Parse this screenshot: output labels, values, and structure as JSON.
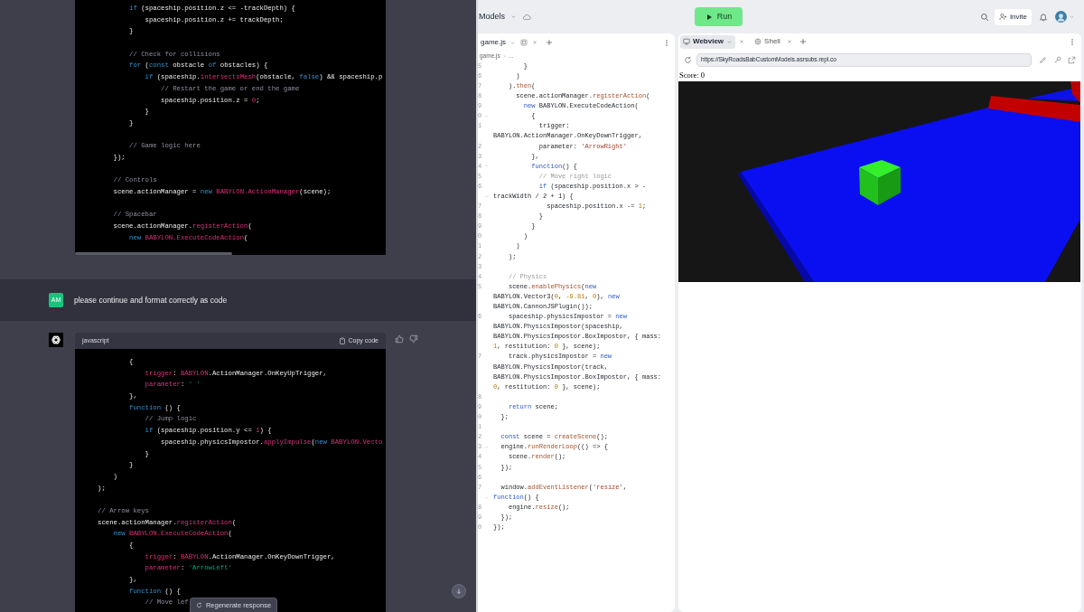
{
  "chat": {
    "code_block_1": {
      "lines": [
        {
          "kind": "code",
          "segments": [
            {
              "text": "        if",
              "kind": "kw"
            },
            {
              "text": " (spaceship.position.z <= -trackDepth) {",
              "kind": "plain"
            }
          ]
        },
        {
          "kind": "code",
          "segments": [
            {
              "text": "            spaceship.position.z += trackDepth;",
              "kind": "plain"
            }
          ]
        },
        {
          "kind": "code",
          "segments": [
            {
              "text": "        }",
              "kind": "plain"
            }
          ]
        },
        {
          "kind": "blank"
        },
        {
          "kind": "code",
          "segments": [
            {
              "text": "        // Check for collisions",
              "kind": "com"
            }
          ]
        },
        {
          "kind": "code",
          "segments": [
            {
              "text": "        for",
              "kind": "kw"
            },
            {
              "text": " (",
              "kind": "plain"
            },
            {
              "text": "const",
              "kind": "kw"
            },
            {
              "text": " obstacle ",
              "kind": "plain"
            },
            {
              "text": "of",
              "kind": "kw"
            },
            {
              "text": " obstacles) {",
              "kind": "plain"
            }
          ]
        },
        {
          "kind": "code",
          "segments": [
            {
              "text": "            if",
              "kind": "kw"
            },
            {
              "text": " (spaceship.",
              "kind": "plain"
            },
            {
              "text": "intersectsMesh",
              "kind": "fn"
            },
            {
              "text": "(obstacle, ",
              "kind": "plain"
            },
            {
              "text": "false",
              "kind": "kw"
            },
            {
              "text": ") && spaceship.p",
              "kind": "plain"
            }
          ]
        },
        {
          "kind": "code",
          "segments": [
            {
              "text": "                // Restart the game or end the game",
              "kind": "com"
            }
          ]
        },
        {
          "kind": "code",
          "segments": [
            {
              "text": "                spaceship.position.z = ",
              "kind": "plain"
            },
            {
              "text": "0",
              "kind": "num"
            },
            {
              "text": ";",
              "kind": "plain"
            }
          ]
        },
        {
          "kind": "code",
          "segments": [
            {
              "text": "            }",
              "kind": "plain"
            }
          ]
        },
        {
          "kind": "code",
          "segments": [
            {
              "text": "        }",
              "kind": "plain"
            }
          ]
        },
        {
          "kind": "blank"
        },
        {
          "kind": "code",
          "segments": [
            {
              "text": "        // Game logic here",
              "kind": "com"
            }
          ]
        },
        {
          "kind": "code",
          "segments": [
            {
              "text": "    });",
              "kind": "plain"
            }
          ]
        },
        {
          "kind": "blank"
        },
        {
          "kind": "code",
          "segments": [
            {
              "text": "    // Controls",
              "kind": "com"
            }
          ]
        },
        {
          "kind": "code",
          "segments": [
            {
              "text": "    scene.actionManager = ",
              "kind": "plain"
            },
            {
              "text": "new",
              "kind": "kw"
            },
            {
              "text": " BABYLON.ActionManager",
              "kind": "fn"
            },
            {
              "text": "(scene);",
              "kind": "plain"
            }
          ]
        },
        {
          "kind": "blank"
        },
        {
          "kind": "code",
          "segments": [
            {
              "text": "    // Spacebar",
              "kind": "com"
            }
          ]
        },
        {
          "kind": "code",
          "segments": [
            {
              "text": "    scene.actionManager.",
              "kind": "plain"
            },
            {
              "text": "registerAction",
              "kind": "fn"
            },
            {
              "text": "(",
              "kind": "plain"
            }
          ]
        },
        {
          "kind": "code",
          "segments": [
            {
              "text": "        new",
              "kind": "kw"
            },
            {
              "text": " BABYLON.ExecuteCodeAction",
              "kind": "fn"
            },
            {
              "text": "(",
              "kind": "plain"
            }
          ]
        }
      ]
    },
    "user_message": {
      "avatar": "AM",
      "text": "please continue and format correctly as code"
    },
    "assistant_message": {
      "code_block": {
        "language": "javascript",
        "copy_label": "Copy code",
        "lines": [
          {
            "kind": "code",
            "segments": [
              {
                "text": "        {",
                "kind": "plain"
              }
            ]
          },
          {
            "kind": "code",
            "segments": [
              {
                "text": "            trigger",
                "kind": "fn"
              },
              {
                "text": ": ",
                "kind": "plain"
              },
              {
                "text": "BABYLON",
                "kind": "fn"
              },
              {
                "text": ".ActionManager.OnKeyUpTrigger,",
                "kind": "plain"
              }
            ]
          },
          {
            "kind": "code",
            "segments": [
              {
                "text": "            parameter",
                "kind": "fn"
              },
              {
                "text": ": ",
                "kind": "plain"
              },
              {
                "text": "' '",
                "kind": "str"
              }
            ]
          },
          {
            "kind": "code",
            "segments": [
              {
                "text": "        },",
                "kind": "plain"
              }
            ]
          },
          {
            "kind": "code",
            "segments": [
              {
                "text": "        function",
                "kind": "kw"
              },
              {
                "text": " () {",
                "kind": "plain"
              }
            ]
          },
          {
            "kind": "code",
            "segments": [
              {
                "text": "            // Jump logic",
                "kind": "com"
              }
            ]
          },
          {
            "kind": "code",
            "segments": [
              {
                "text": "            if",
                "kind": "kw"
              },
              {
                "text": " (spaceship.position.y <= ",
                "kind": "plain"
              },
              {
                "text": "1",
                "kind": "num"
              },
              {
                "text": ") {",
                "kind": "plain"
              }
            ]
          },
          {
            "kind": "code",
            "segments": [
              {
                "text": "                spaceship.physicsImpostor.",
                "kind": "plain"
              },
              {
                "text": "applyImpulse",
                "kind": "fn"
              },
              {
                "text": "(",
                "kind": "plain"
              },
              {
                "text": "new",
                "kind": "kw"
              },
              {
                "text": " BABYLON.Vecto",
                "kind": "fn"
              }
            ]
          },
          {
            "kind": "code",
            "segments": [
              {
                "text": "            }",
                "kind": "plain"
              }
            ]
          },
          {
            "kind": "code",
            "segments": [
              {
                "text": "        }",
                "kind": "plain"
              }
            ]
          },
          {
            "kind": "code",
            "segments": [
              {
                "text": "    )",
                "kind": "plain"
              }
            ]
          },
          {
            "kind": "code",
            "segments": [
              {
                "text": ");",
                "kind": "plain"
              }
            ]
          },
          {
            "kind": "blank"
          },
          {
            "kind": "code",
            "segments": [
              {
                "text": "// Arrow keys",
                "kind": "com"
              }
            ]
          },
          {
            "kind": "code",
            "segments": [
              {
                "text": "scene.actionManager.",
                "kind": "plain"
              },
              {
                "text": "registerAction",
                "kind": "fn"
              },
              {
                "text": "(",
                "kind": "plain"
              }
            ]
          },
          {
            "kind": "code",
            "segments": [
              {
                "text": "    new",
                "kind": "kw"
              },
              {
                "text": " BABYLON.ExecuteCodeAction",
                "kind": "fn"
              },
              {
                "text": "(",
                "kind": "plain"
              }
            ]
          },
          {
            "kind": "code",
            "segments": [
              {
                "text": "        {",
                "kind": "plain"
              }
            ]
          },
          {
            "kind": "code",
            "segments": [
              {
                "text": "            trigger",
                "kind": "fn"
              },
              {
                "text": ": ",
                "kind": "plain"
              },
              {
                "text": "BABYLON",
                "kind": "fn"
              },
              {
                "text": ".ActionManager.OnKeyDownTrigger,",
                "kind": "plain"
              }
            ]
          },
          {
            "kind": "code",
            "segments": [
              {
                "text": "            parameter",
                "kind": "fn"
              },
              {
                "text": ": ",
                "kind": "plain"
              },
              {
                "text": "'ArrowLeft'",
                "kind": "str"
              }
            ]
          },
          {
            "kind": "code",
            "segments": [
              {
                "text": "        },",
                "kind": "plain"
              }
            ]
          },
          {
            "kind": "code",
            "segments": [
              {
                "text": "        function",
                "kind": "kw"
              },
              {
                "text": " () {",
                "kind": "plain"
              }
            ]
          },
          {
            "kind": "code",
            "segments": [
              {
                "text": "            // Move lef",
                "kind": "com"
              }
            ]
          }
        ]
      }
    },
    "regenerate_button": "Regenerate response"
  },
  "replit": {
    "project_name": "Models",
    "run_button": "Run",
    "invite_button": "Invite",
    "editor": {
      "tabs": [
        {
          "label": "game.js"
        }
      ],
      "breadcrumb": [
        "game.js",
        "..."
      ],
      "lines": [
        {
          "number": "5",
          "kind": "code",
          "fold": false,
          "rows": [
            {
              "segments": [
                {
                  "text": "        }",
                  "kind": "plain"
                }
              ]
            }
          ]
        },
        {
          "number": "6",
          "kind": "code",
          "fold": false,
          "rows": [
            {
              "segments": [
                {
                  "text": "      )",
                  "kind": "plain"
                }
              ]
            }
          ]
        },
        {
          "number": "7",
          "kind": "code",
          "fold": false,
          "rows": [
            {
              "segments": [
                {
                  "text": "    ).",
                  "kind": "plain"
                },
                {
                  "text": "then",
                  "kind": "fn"
                },
                {
                  "text": "(",
                  "kind": "plain"
                }
              ]
            }
          ]
        },
        {
          "number": "8",
          "kind": "code",
          "fold": false,
          "rows": [
            {
              "segments": [
                {
                  "text": "      scene.actionManager.",
                  "kind": "plain"
                },
                {
                  "text": "registerAction",
                  "kind": "fn"
                },
                {
                  "text": "(",
                  "kind": "plain"
                }
              ]
            }
          ]
        },
        {
          "number": "9",
          "kind": "code",
          "fold": false,
          "rows": [
            {
              "segments": [
                {
                  "text": "        new",
                  "kind": "kw"
                },
                {
                  "text": " BABYLON.ExecuteCodeAction(",
                  "kind": "plain"
                }
              ]
            }
          ]
        },
        {
          "number": "0",
          "kind": "code",
          "fold": true,
          "rows": [
            {
              "segments": [
                {
                  "text": "          {",
                  "kind": "plain"
                }
              ]
            }
          ]
        },
        {
          "number": "1",
          "kind": "code",
          "fold": false,
          "rows": [
            {
              "segments": [
                {
                  "text": "            trigger:",
                  "kind": "plain"
                }
              ]
            },
            {
              "segments": [
                {
                  "text": "BABYLON.ActionManager.OnKeyDownTrigger,",
                  "kind": "plain"
                }
              ]
            }
          ]
        },
        {
          "number": "2",
          "kind": "code",
          "fold": false,
          "rows": [
            {
              "segments": [
                {
                  "text": "            parameter: ",
                  "kind": "plain"
                },
                {
                  "text": "'ArrowRight'",
                  "kind": "str"
                }
              ]
            }
          ]
        },
        {
          "number": "3",
          "kind": "code",
          "fold": false,
          "rows": [
            {
              "segments": [
                {
                  "text": "          },",
                  "kind": "plain"
                }
              ]
            }
          ]
        },
        {
          "number": "4",
          "kind": "code",
          "fold": true,
          "rows": [
            {
              "segments": [
                {
                  "text": "          function",
                  "kind": "kw"
                },
                {
                  "text": "() {",
                  "kind": "plain"
                }
              ]
            }
          ]
        },
        {
          "number": "5",
          "kind": "code",
          "fold": false,
          "rows": [
            {
              "segments": [
                {
                  "text": "            // Move right logic",
                  "kind": "com"
                }
              ]
            }
          ]
        },
        {
          "number": "6",
          "kind": "code",
          "fold": true,
          "rows": [
            {
              "segments": [
                {
                  "text": "            if",
                  "kind": "kw"
                },
                {
                  "text": " (spaceship.position.x > -",
                  "kind": "plain"
                }
              ]
            },
            {
              "segments": [
                {
                  "text": "trackWidth / 2 + 1) {",
                  "kind": "plain"
                }
              ]
            }
          ]
        },
        {
          "number": "7",
          "kind": "code",
          "fold": false,
          "rows": [
            {
              "segments": [
                {
                  "text": "              spaceship.position.x -= ",
                  "kind": "plain"
                },
                {
                  "text": "1",
                  "kind": "num"
                },
                {
                  "text": ";",
                  "kind": "plain"
                }
              ]
            }
          ]
        },
        {
          "number": "8",
          "kind": "code",
          "fold": false,
          "rows": [
            {
              "segments": [
                {
                  "text": "            }",
                  "kind": "plain"
                }
              ]
            }
          ]
        },
        {
          "number": "9",
          "kind": "code",
          "fold": false,
          "rows": [
            {
              "segments": [
                {
                  "text": "          }",
                  "kind": "plain"
                }
              ]
            }
          ]
        },
        {
          "number": "0",
          "kind": "code",
          "fold": false,
          "rows": [
            {
              "segments": [
                {
                  "text": "        )",
                  "kind": "plain"
                }
              ]
            }
          ]
        },
        {
          "number": "1",
          "kind": "code",
          "fold": false,
          "rows": [
            {
              "segments": [
                {
                  "text": "      )",
                  "kind": "plain"
                }
              ]
            }
          ]
        },
        {
          "number": "2",
          "kind": "code",
          "fold": false,
          "rows": [
            {
              "segments": [
                {
                  "text": "    );",
                  "kind": "plain"
                }
              ]
            }
          ]
        },
        {
          "number": "3",
          "kind": "blank",
          "fold": false
        },
        {
          "number": "4",
          "kind": "code",
          "fold": false,
          "rows": [
            {
              "segments": [
                {
                  "text": "    // Physics",
                  "kind": "com"
                }
              ]
            }
          ]
        },
        {
          "number": "5",
          "kind": "code",
          "fold": false,
          "rows": [
            {
              "segments": [
                {
                  "text": "    scene.",
                  "kind": "plain"
                },
                {
                  "text": "enablePhysics",
                  "kind": "fn"
                },
                {
                  "text": "(",
                  "kind": "plain"
                },
                {
                  "text": "new",
                  "kind": "kw"
                }
              ]
            },
            {
              "segments": [
                {
                  "text": "BABYLON.Vector3(",
                  "kind": "plain"
                },
                {
                  "text": "0",
                  "kind": "num"
                },
                {
                  "text": ", ",
                  "kind": "plain"
                },
                {
                  "text": "-9.81",
                  "kind": "num"
                },
                {
                  "text": ", ",
                  "kind": "plain"
                },
                {
                  "text": "0",
                  "kind": "num"
                },
                {
                  "text": "), ",
                  "kind": "plain"
                },
                {
                  "text": "new",
                  "kind": "kw"
                }
              ]
            },
            {
              "segments": [
                {
                  "text": "BABYLON.CannonJSPlugin());",
                  "kind": "plain"
                }
              ]
            }
          ]
        },
        {
          "number": "6",
          "kind": "code",
          "fold": false,
          "rows": [
            {
              "segments": [
                {
                  "text": "    spaceship.physicsImpostor = ",
                  "kind": "plain"
                },
                {
                  "text": "new",
                  "kind": "kw"
                }
              ]
            },
            {
              "segments": [
                {
                  "text": "BABYLON.PhysicsImpostor(spaceship,",
                  "kind": "plain"
                }
              ]
            },
            {
              "segments": [
                {
                  "text": "BABYLON.PhysicsImpostor.BoxImpostor, { mass:",
                  "kind": "plain"
                }
              ]
            },
            {
              "segments": [
                {
                  "text": "1",
                  "kind": "num"
                },
                {
                  "text": ", restitution: ",
                  "kind": "plain"
                },
                {
                  "text": "0",
                  "kind": "num"
                },
                {
                  "text": " }, scene);",
                  "kind": "plain"
                }
              ]
            }
          ]
        },
        {
          "number": "7",
          "kind": "code",
          "fold": false,
          "rows": [
            {
              "segments": [
                {
                  "text": "    track.physicsImpostor = ",
                  "kind": "plain"
                },
                {
                  "text": "new",
                  "kind": "kw"
                }
              ]
            },
            {
              "segments": [
                {
                  "text": "BABYLON.PhysicsImpostor(track,",
                  "kind": "plain"
                }
              ]
            },
            {
              "segments": [
                {
                  "text": "BABYLON.PhysicsImpostor.BoxImpostor, { mass:",
                  "kind": "plain"
                }
              ]
            },
            {
              "segments": [
                {
                  "text": "0",
                  "kind": "num"
                },
                {
                  "text": ", restitution: ",
                  "kind": "plain"
                },
                {
                  "text": "0",
                  "kind": "num"
                },
                {
                  "text": " }, scene);",
                  "kind": "plain"
                }
              ]
            }
          ]
        },
        {
          "number": "8",
          "kind": "blank",
          "fold": false
        },
        {
          "number": "9",
          "kind": "code",
          "fold": false,
          "rows": [
            {
              "segments": [
                {
                  "text": "    return",
                  "kind": "kw"
                },
                {
                  "text": " scene;",
                  "kind": "plain"
                }
              ]
            }
          ]
        },
        {
          "number": "0",
          "kind": "code",
          "fold": false,
          "rows": [
            {
              "segments": [
                {
                  "text": "  };",
                  "kind": "plain"
                }
              ]
            }
          ]
        },
        {
          "number": "1",
          "kind": "blank",
          "fold": false
        },
        {
          "number": "2",
          "kind": "code",
          "fold": false,
          "rows": [
            {
              "segments": [
                {
                  "text": "  const",
                  "kind": "kw"
                },
                {
                  "text": " scene = ",
                  "kind": "plain"
                },
                {
                  "text": "createScene",
                  "kind": "fn"
                },
                {
                  "text": "();",
                  "kind": "plain"
                }
              ]
            }
          ]
        },
        {
          "number": "3",
          "kind": "code",
          "fold": true,
          "rows": [
            {
              "segments": [
                {
                  "text": "  engine.",
                  "kind": "plain"
                },
                {
                  "text": "runRenderLoop",
                  "kind": "fn"
                },
                {
                  "text": "(() => {",
                  "kind": "plain"
                }
              ]
            }
          ]
        },
        {
          "number": "4",
          "kind": "code",
          "fold": false,
          "rows": [
            {
              "segments": [
                {
                  "text": "    scene.",
                  "kind": "plain"
                },
                {
                  "text": "render",
                  "kind": "fn"
                },
                {
                  "text": "();",
                  "kind": "plain"
                }
              ]
            }
          ]
        },
        {
          "number": "5",
          "kind": "code",
          "fold": false,
          "rows": [
            {
              "segments": [
                {
                  "text": "  });",
                  "kind": "plain"
                }
              ]
            }
          ]
        },
        {
          "number": "6",
          "kind": "blank",
          "fold": false
        },
        {
          "number": "7",
          "kind": "code",
          "fold": true,
          "rows": [
            {
              "segments": [
                {
                  "text": "  window.",
                  "kind": "plain"
                },
                {
                  "text": "addEventListener",
                  "kind": "fn"
                },
                {
                  "text": "(",
                  "kind": "plain"
                },
                {
                  "text": "'resize'",
                  "kind": "str"
                },
                {
                  "text": ",",
                  "kind": "plain"
                }
              ]
            },
            {
              "segments": [
                {
                  "text": "function",
                  "kind": "kw"
                },
                {
                  "text": "() {",
                  "kind": "plain"
                }
              ]
            }
          ]
        },
        {
          "number": "8",
          "kind": "code",
          "fold": false,
          "rows": [
            {
              "segments": [
                {
                  "text": "    engine.",
                  "kind": "plain"
                },
                {
                  "text": "resize",
                  "kind": "fn"
                },
                {
                  "text": "();",
                  "kind": "plain"
                }
              ]
            }
          ]
        },
        {
          "number": "9",
          "kind": "code",
          "fold": false,
          "rows": [
            {
              "segments": [
                {
                  "text": "  });",
                  "kind": "plain"
                }
              ]
            }
          ]
        },
        {
          "number": "0",
          "kind": "code",
          "fold": false,
          "rows": [
            {
              "segments": [
                {
                  "text": "});",
                  "kind": "plain"
                }
              ]
            }
          ]
        }
      ]
    },
    "webview": {
      "tabs": [
        {
          "label": "Webview",
          "kind": "webview",
          "selected": true
        },
        {
          "label": "Shell",
          "kind": "shell",
          "selected": false
        }
      ],
      "url": "https://SkyRoadsBabCustomModels.asrsubs.repl.co",
      "score": "Score: 0"
    }
  }
}
